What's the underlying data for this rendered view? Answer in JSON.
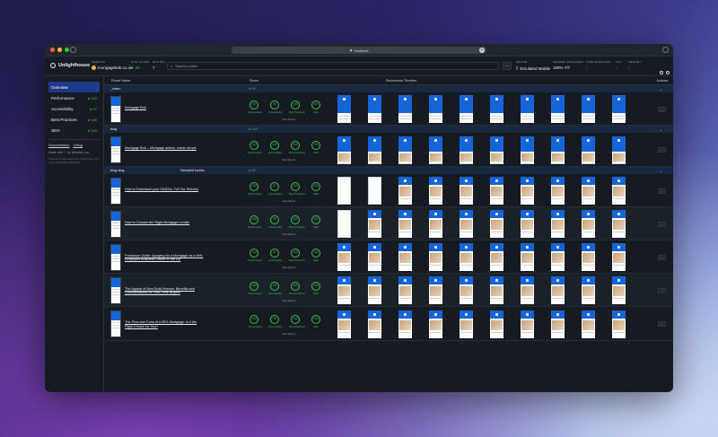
{
  "browser": {
    "url": "localhost"
  },
  "header": {
    "app_name": "Unlighthouse",
    "website_label": "WEBSITE",
    "website_value": "mortgagebob.co.uk",
    "site_score_label": "SITE SCORE",
    "site_score_value": "98",
    "routes_label": "ROUTES",
    "routes_value": "7",
    "search_placeholder": "Search routes",
    "device_label": "DEVICE",
    "device_value": "Emulated Mobile",
    "worker_label": "WORKER PROGRESS",
    "worker_value": "100% 7/7",
    "time_label": "TIME REMAINING",
    "time_value": "-",
    "cpu_label": "CPU",
    "cpu_value": "-",
    "memory_label": "MEMORY",
    "memory_value": "-"
  },
  "sidebar": {
    "items": [
      {
        "label": "Overview",
        "score": ""
      },
      {
        "label": "Performance",
        "score": "100"
      },
      {
        "label": "Accessibility",
        "score": "97"
      },
      {
        "label": "Best Practices",
        "score": "100"
      },
      {
        "label": "SEO",
        "score": "100"
      }
    ],
    "documentation": "Documentation",
    "debug": "Debug",
    "made_with": "Made with ♡ by @harlan_zw",
    "note": "Portions of this report use Lighthouse. For more information visit here."
  },
  "table": {
    "col_route": "Route Name",
    "col_score": "Score",
    "col_timeline": "Screenshot Timeline",
    "col_actions": "Actions",
    "score_labels": [
      "Performance",
      "Accessibility",
      "Best Practices",
      "SEO"
    ],
    "view_report": "View Report"
  },
  "groups": [
    {
      "name": "_index",
      "sample": "",
      "score": "99"
    },
    {
      "name": "blog",
      "sample": "",
      "score": "100"
    },
    {
      "name": "blog-slug",
      "sample": "Sampled routes",
      "score": "99"
    }
  ],
  "rows": [
    {
      "name": "Mortgage Bob",
      "scores": [
        "98",
        "95",
        "100",
        "100"
      ]
    },
    {
      "name": "Mortgage Bob – Mortgage advice, made simple",
      "scores": [
        "100",
        "100",
        "100",
        "100"
      ]
    },
    {
      "name": "How to Download your SA302s: Full Tax Returns",
      "scores": [
        "100",
        "97",
        "100",
        "100"
      ]
    },
    {
      "name": "How to Choose the Right Mortgage Lender",
      "scores": [
        "100",
        "95",
        "100",
        "100"
      ]
    },
    {
      "name": "Freelance Guide: Applying for a Mortgage as a Self-Employed Business Owner in the UK",
      "scores": [
        "100",
        "97",
        "100",
        "100"
      ]
    },
    {
      "name": "The Appeal of New Build Homes: Benefits and Considerations for First-Time Buyers",
      "scores": [
        "100",
        "95",
        "100",
        "100"
      ]
    },
    {
      "name": "The Pros and Cons of a 95% Mortgage: Is it the Right Choice for You?",
      "scores": [
        "100",
        "95",
        "100",
        "100"
      ]
    }
  ],
  "colors": {
    "accent": "#1f3a8a",
    "good": "#3fb950",
    "brand_blue": "#1565d8"
  }
}
